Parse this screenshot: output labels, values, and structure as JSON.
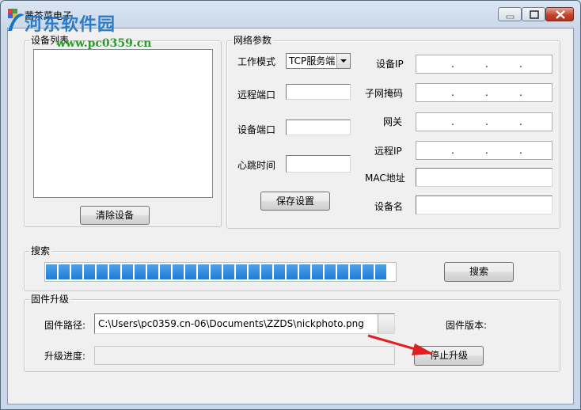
{
  "window": {
    "title": "茜茶菜电子"
  },
  "watermark": {
    "brand": "河东软件园",
    "url": "www.pc0359.cn"
  },
  "device_list": {
    "title": "设备列表",
    "clear_button": "清除设备"
  },
  "network": {
    "title": "网络参数",
    "work_mode_label": "工作模式",
    "work_mode_value": "TCP服务端",
    "remote_port_label": "远程端口",
    "device_port_label": "设备端口",
    "heartbeat_label": "心跳时间",
    "save_button": "保存设置",
    "device_ip_label": "设备IP",
    "subnet_label": "子网掩码",
    "gateway_label": "网关",
    "remote_ip_label": "远程IP",
    "mac_label": "MAC地址",
    "device_name_label": "设备名",
    "ip_dot": "."
  },
  "search": {
    "title": "搜索",
    "button": "搜索",
    "progress_fraction": 1.0
  },
  "firmware": {
    "title": "固件升级",
    "path_label": "固件路径:",
    "path_value": "C:\\Users\\pc0359.cn-06\\Documents\\ZZDS\\nickphoto.png",
    "version_label": "固件版本:",
    "progress_label": "升级进度:",
    "stop_button": "停止升级"
  },
  "colors": {
    "accent": "#1f7bd6",
    "arrow": "#e02020"
  }
}
